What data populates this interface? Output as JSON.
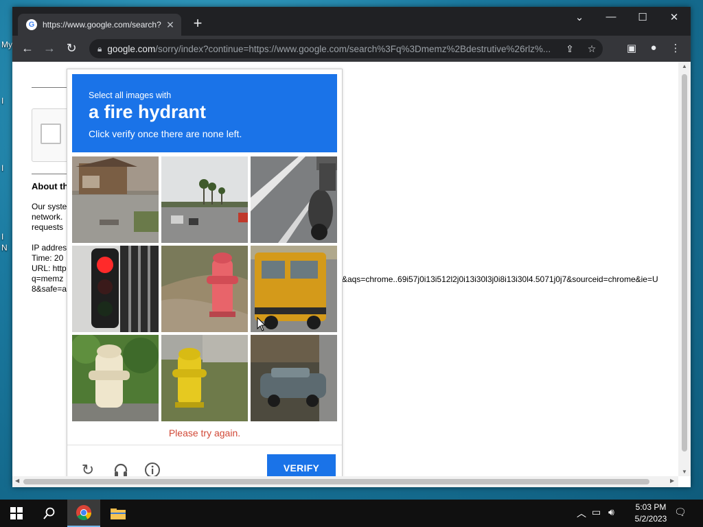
{
  "desktop": {
    "labels": [
      "My",
      "I",
      "I",
      "I",
      "N"
    ]
  },
  "browser": {
    "tab_title": "https://www.google.com/search?",
    "address": {
      "domain": "google.com",
      "path": "/sorry/index?continue=https://www.google.com/search%3Fq%3Dmemz%2Bdestrutive%26rlz%..."
    }
  },
  "page": {
    "about_heading": "About th",
    "para1": [
      "Our syste",
      "network.",
      "requests"
    ],
    "para2": [
      "IP addres",
      "Time: 20",
      "URL: http",
      "q=memz",
      "8&safe=a"
    ],
    "url_tail": "&aqs=chrome..69i57j0i13i512l2j0i13i30l3j0i8i13i30l4.5071j0j7&sourceid=chrome&ie=U"
  },
  "captcha": {
    "line1": "Select all images with",
    "target": "a fire hydrant",
    "line3": "Click verify once there are none left.",
    "tiles": [
      {
        "name": "tile-house-street",
        "has_target": false
      },
      {
        "name": "tile-road-palms",
        "has_target": false
      },
      {
        "name": "tile-motorcycle",
        "has_target": false
      },
      {
        "name": "tile-traffic-light",
        "has_target": false
      },
      {
        "name": "tile-red-hydrant",
        "has_target": true
      },
      {
        "name": "tile-school-bus",
        "has_target": false
      },
      {
        "name": "tile-white-hydrant",
        "has_target": true
      },
      {
        "name": "tile-yellow-hydrant",
        "has_target": true
      },
      {
        "name": "tile-parked-car",
        "has_target": false
      }
    ],
    "error": "Please try again.",
    "verify_label": "VERIFY",
    "colors": {
      "header": "#1a73e8",
      "error": "#d14836"
    }
  },
  "taskbar": {
    "time": "5:03 PM",
    "date": "5/2/2023"
  }
}
